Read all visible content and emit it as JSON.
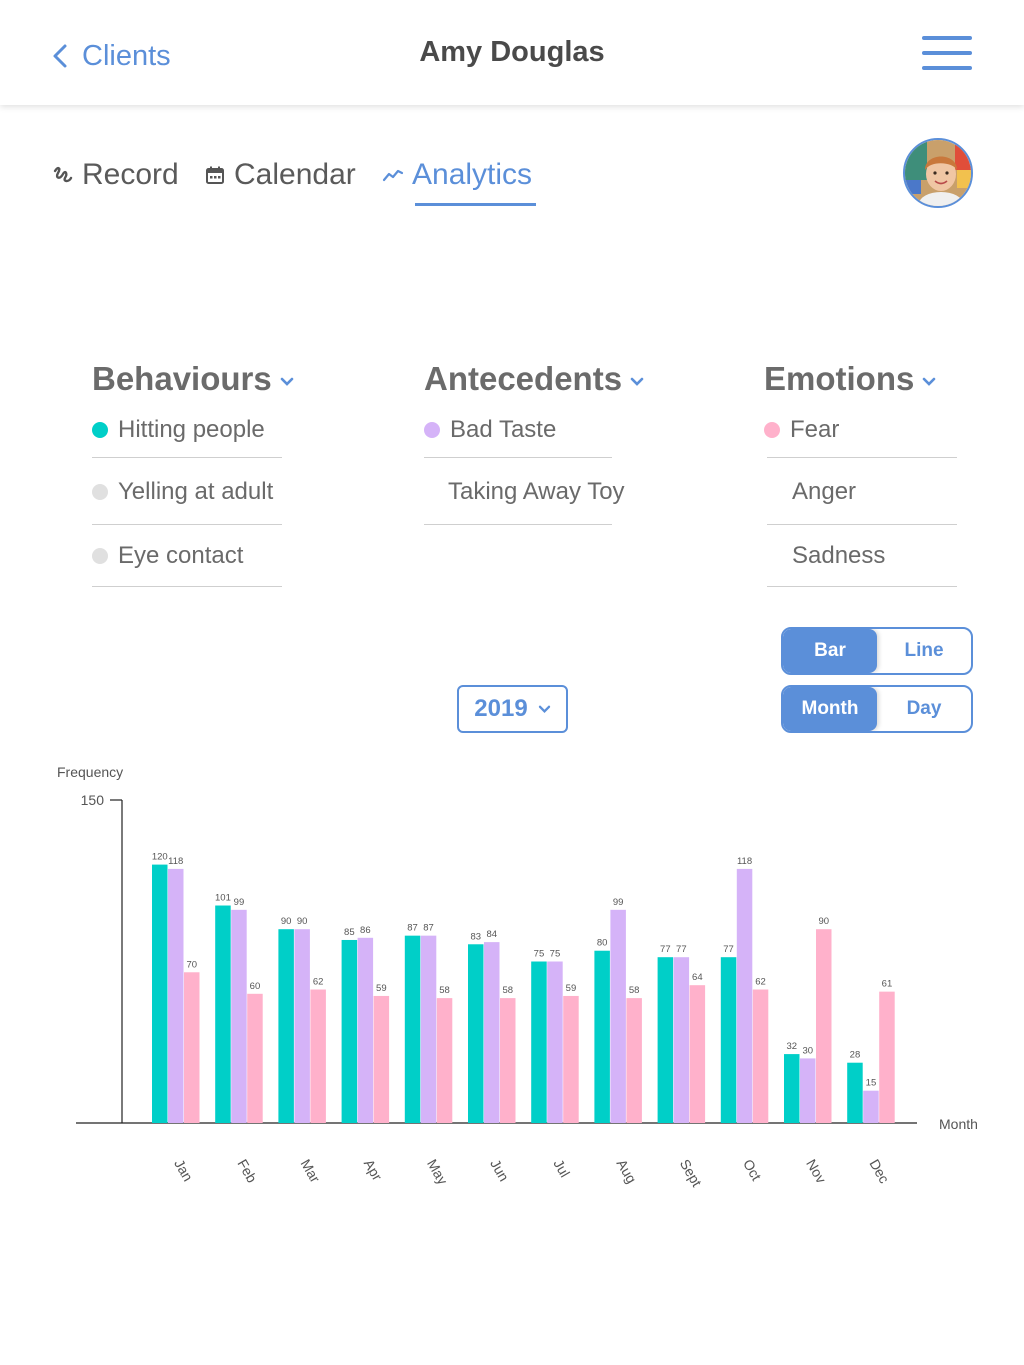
{
  "header": {
    "back_label": "Clients",
    "title": "Amy Douglas"
  },
  "tabs": [
    {
      "label": "Record",
      "icon": "scribble-icon",
      "active": false
    },
    {
      "label": "Calendar",
      "icon": "calendar-icon",
      "active": false
    },
    {
      "label": "Analytics",
      "icon": "trend-line-icon",
      "active": true
    }
  ],
  "colors": {
    "accent": "#5b8fd9",
    "teal": "#00cfc8",
    "lavender": "#d5b3f8",
    "pink": "#ffb1cb",
    "inactive_dot": "#e0e0e0"
  },
  "filters": {
    "behaviours": {
      "title": "Behaviours",
      "items": [
        "Hitting people",
        "Yelling at adult",
        "Eye contact"
      ]
    },
    "antecedents": {
      "title": "Antecedents",
      "items": [
        "Bad Taste",
        "Taking Away Toy"
      ]
    },
    "emotions": {
      "title": "Emotions",
      "items": [
        "Fear",
        "Anger",
        "Sadness"
      ]
    }
  },
  "view_toggle": {
    "bar": "Bar",
    "line": "Line",
    "selected": "Bar"
  },
  "period_toggle": {
    "month": "Month",
    "day": "Day",
    "selected": "Month"
  },
  "year_select": {
    "value": "2019"
  },
  "chart_data": {
    "type": "bar",
    "xlabel": "Month",
    "ylabel": "Frequency",
    "ylim": [
      0,
      150
    ],
    "y_ticks": [
      150
    ],
    "categories": [
      "Jan",
      "Feb",
      "Mar",
      "Apr",
      "May",
      "Jun",
      "Jul",
      "Aug",
      "Sept",
      "Oct",
      "Nov",
      "Dec"
    ],
    "series": [
      {
        "color": "#00cfc8",
        "values": [
          120,
          101,
          90,
          85,
          87,
          83,
          75,
          80,
          77,
          77,
          32,
          28
        ]
      },
      {
        "color": "#d5b3f8",
        "values": [
          118,
          99,
          90,
          86,
          87,
          84,
          75,
          99,
          77,
          118,
          30,
          15
        ]
      },
      {
        "color": "#ffb1cb",
        "values": [
          70,
          60,
          62,
          59,
          58,
          58,
          59,
          58,
          64,
          62,
          90,
          61
        ]
      }
    ]
  }
}
